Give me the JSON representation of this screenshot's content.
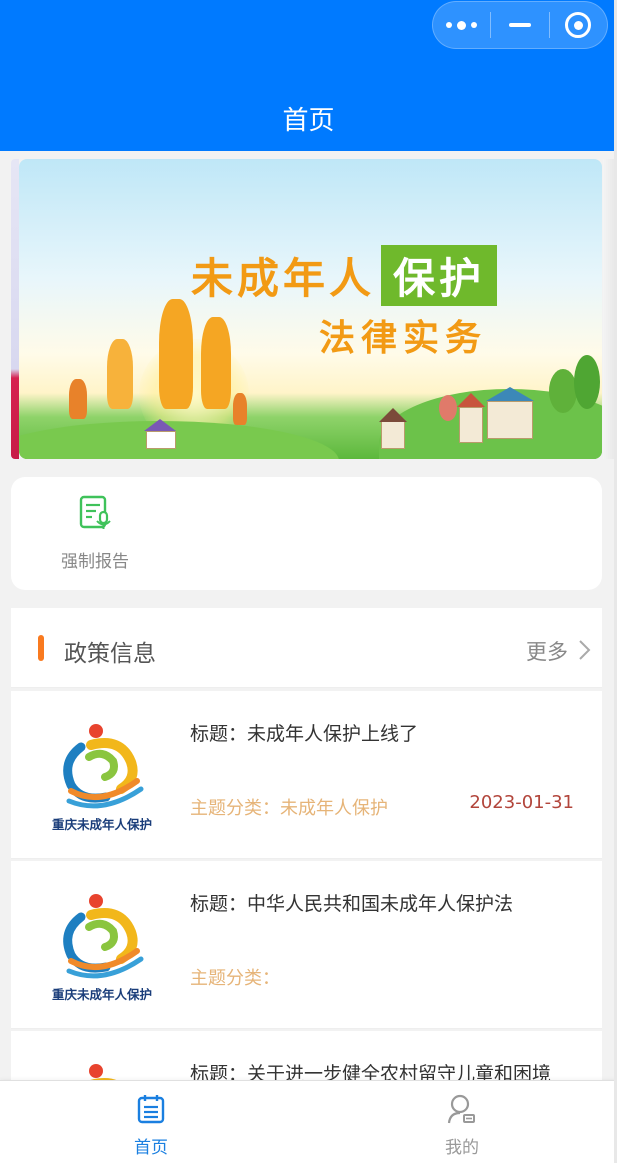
{
  "header": {
    "title": "首页",
    "capsule": {
      "more_icon": "more-dots-icon",
      "minimize_icon": "minimize-icon",
      "close_icon": "target-icon"
    },
    "color": "#007aff"
  },
  "banner": {
    "title_part1": "未成年人",
    "title_part2": "保护",
    "subtitle": "法律实务"
  },
  "quick_menu": {
    "items": [
      {
        "label": "强制报告",
        "icon": "report-mic-icon"
      }
    ]
  },
  "policy_section": {
    "title": "政策信息",
    "more_label": "更多",
    "accent": "#f97a1f",
    "logo_text": "重庆未成年人保护",
    "cards": [
      {
        "title": "标题：未成年人保护上线了",
        "category": "主题分类：未成年人保护",
        "date": "2023-01-31"
      },
      {
        "title": "标题：中华人民共和国未成年人保护法",
        "category": "主题分类：",
        "date": ""
      },
      {
        "title": "标题：关于进一步健全农村留守儿童和困境",
        "category": "",
        "date": ""
      }
    ]
  },
  "tabbar": {
    "tabs": [
      {
        "label": "首页",
        "icon": "home-list-icon",
        "active": true
      },
      {
        "label": "我的",
        "icon": "user-icon",
        "active": false
      }
    ],
    "active_color": "#1a7fe0"
  }
}
